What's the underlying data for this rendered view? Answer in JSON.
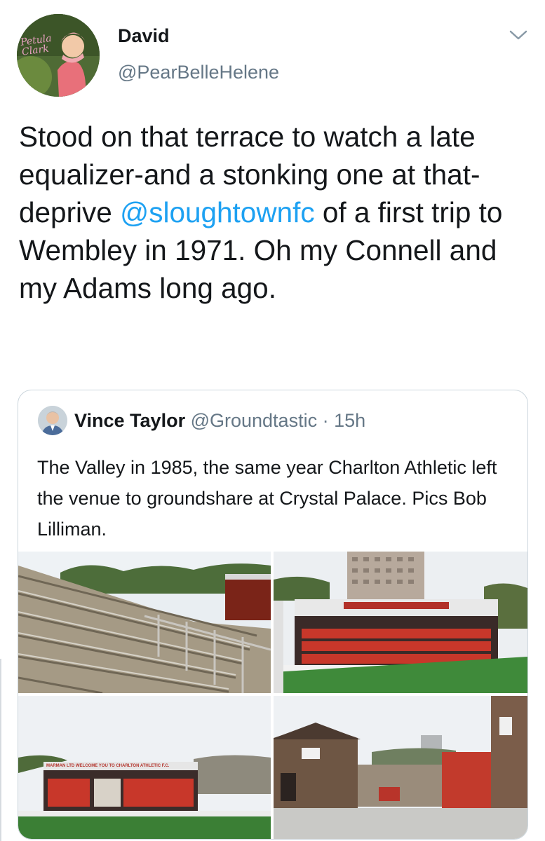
{
  "tweet": {
    "author_name": "David",
    "author_handle": "@PearBelleHelene",
    "avatar_caption": "Petula Clark",
    "text_before_mention": "Stood on that terrace to watch a late equalizer-and a stonking one at that-deprive ",
    "mention": "@sloughtownfc",
    "text_after_mention": " of a first trip to Wembley in 1971. Oh my Connell and my Adams long ago."
  },
  "quoted_tweet": {
    "author_name": "Vince Taylor",
    "author_handle": "@Groundtastic",
    "separator": " · ",
    "time": "15h",
    "text": "The Valley in 1985, the same year Charlton Athletic left the venue to groundshare at Crystal Palace.  Pics Bob Lilliman.",
    "photos": [
      {
        "description": "terrace-steps"
      },
      {
        "description": "stand-red-seats"
      },
      {
        "description": "main-stand",
        "sign_text": "MARMAN LTD  WELCOME YOU TO CHARLTON ATHLETIC F.C."
      },
      {
        "description": "ground-entrance"
      }
    ]
  },
  "colors": {
    "text": "#14171a",
    "secondary": "#657786",
    "link": "#1da1f2",
    "border": "#ccd6dd"
  }
}
